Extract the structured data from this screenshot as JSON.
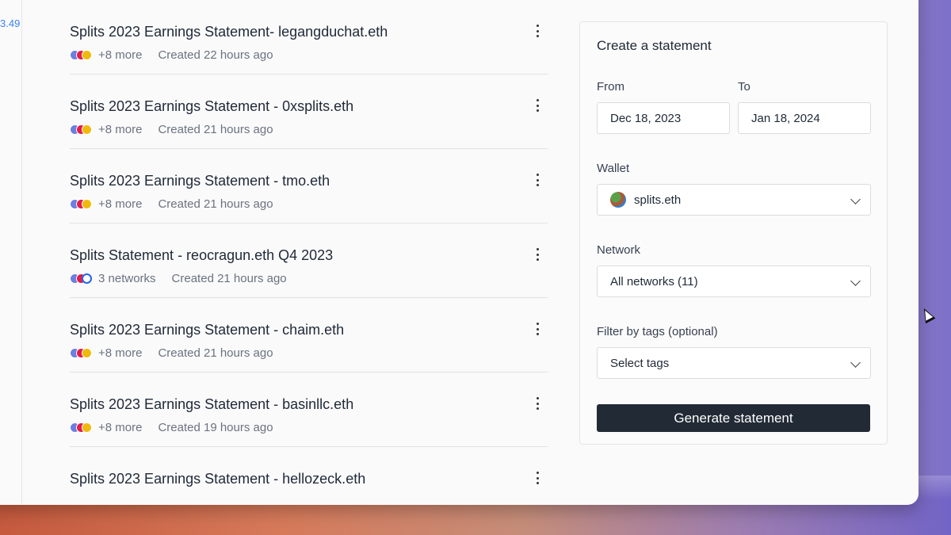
{
  "sidebar": {
    "value": "3.49"
  },
  "statements": [
    {
      "title": "Splits 2023 Earnings Statement- legangduchat.eth",
      "networks_label": "+8 more",
      "created": "Created 22 hours ago"
    },
    {
      "title": "Splits 2023 Earnings Statement - 0xsplits.eth",
      "networks_label": "+8 more",
      "created": "Created 21 hours ago"
    },
    {
      "title": "Splits 2023 Earnings Statement - tmo.eth",
      "networks_label": "+8 more",
      "created": "Created 21 hours ago"
    },
    {
      "title": "Splits Statement - reocragun.eth Q4 2023",
      "networks_label": "3 networks",
      "created": "Created 21 hours ago"
    },
    {
      "title": "Splits 2023 Earnings Statement - chaim.eth",
      "networks_label": "+8 more",
      "created": "Created 21 hours ago"
    },
    {
      "title": "Splits 2023 Earnings Statement - basinllc.eth",
      "networks_label": "+8 more",
      "created": "Created 19 hours ago"
    },
    {
      "title": "Splits 2023 Earnings Statement - hellozeck.eth",
      "networks_label": "",
      "created": ""
    }
  ],
  "panel": {
    "title": "Create a statement",
    "from_label": "From",
    "from_value": "Dec 18, 2023",
    "to_label": "To",
    "to_value": "Jan 18, 2024",
    "wallet_label": "Wallet",
    "wallet_value": "splits.eth",
    "network_label": "Network",
    "network_value": "All networks (11)",
    "tags_label": "Filter by tags (optional)",
    "tags_placeholder": "Select tags",
    "generate_label": "Generate statement"
  },
  "colors": {
    "accent_link": "#3b82f6",
    "button_bg": "#222a35"
  }
}
